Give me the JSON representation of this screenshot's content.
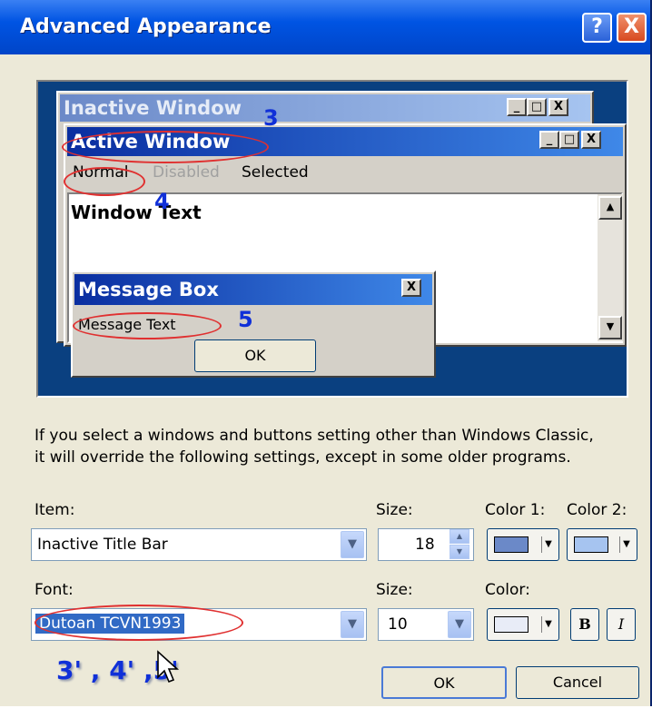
{
  "dialog": {
    "title": "Advanced Appearance",
    "help_glyph": "?",
    "close_glyph": "X"
  },
  "preview": {
    "inactive_title": "Inactive Window",
    "active_title": "Active Window",
    "menu": {
      "normal": "Normal",
      "disabled": "Disabled",
      "selected": "Selected"
    },
    "window_text": "Window Text",
    "message_box": {
      "title": "Message Box",
      "text": "Message Text",
      "ok_label": "OK"
    },
    "caption_buttons": {
      "minimize": "_",
      "maximize": "□",
      "close": "X"
    }
  },
  "annotations": {
    "n3": "3",
    "n4": "4",
    "n5": "5",
    "bottom": "3' , 4' ,5'"
  },
  "info_text": {
    "line1": "If you select a windows and buttons setting other than Windows Classic,",
    "line2": "it will override the following settings, except in some older programs."
  },
  "item_row": {
    "item_label": "Item:",
    "item_value": "Inactive Title Bar",
    "size_label": "Size:",
    "size_value": "18",
    "color1_label": "Color 1:",
    "color2_label": "Color 2:",
    "color1": "#6b89c8",
    "color2": "#a6c4f0"
  },
  "font_row": {
    "font_label": "Font:",
    "font_value": "Dutoan TCVN1993",
    "size_label": "Size:",
    "size_value": "10",
    "color_label": "Color:",
    "color": "#e8ecf7",
    "bold_label": "B",
    "italic_label": "I"
  },
  "buttons": {
    "ok": "OK",
    "cancel": "Cancel"
  },
  "colors": {
    "title_bar": "#0054e3",
    "preview_bg": "#0a4080",
    "annotation": "#1030d8",
    "highlight": "#e03030",
    "selection": "#316ac5"
  }
}
